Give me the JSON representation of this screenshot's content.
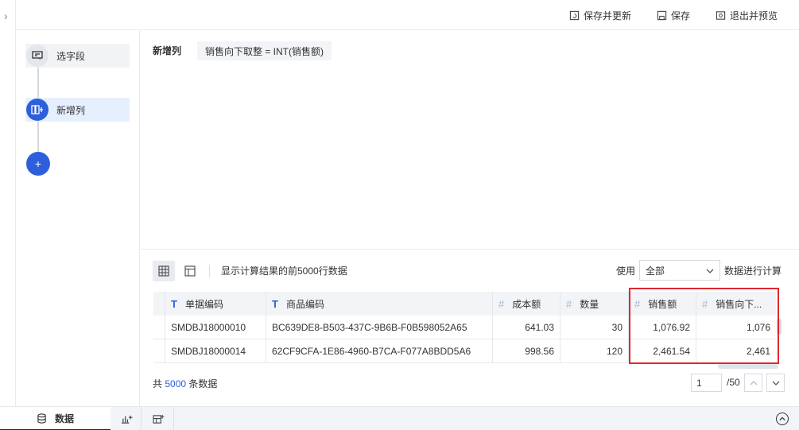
{
  "toolbar": {
    "save_refresh": "保存并更新",
    "save": "保存",
    "exit_preview": "退出并预览"
  },
  "steps": [
    {
      "label": "选字段",
      "icon": "select-field-icon"
    },
    {
      "label": "新增列",
      "icon": "add-column-icon",
      "badge": "ᵢ",
      "active": true
    }
  ],
  "add_step_label": "+",
  "formula": {
    "title": "新增列",
    "expression": "销售向下取整 = INT(销售额)"
  },
  "preview": {
    "hint": "显示计算结果的前5000行数据",
    "use_label": "使用",
    "scope_value": "全部",
    "scope_suffix": "数据进行计算"
  },
  "table": {
    "columns": [
      {
        "label": "单据编码",
        "type": "text"
      },
      {
        "label": "商品编码",
        "type": "text"
      },
      {
        "label": "成本额",
        "type": "number"
      },
      {
        "label": "数量",
        "type": "number"
      },
      {
        "label": "销售额",
        "type": "number"
      },
      {
        "label": "销售向下...",
        "type": "number"
      }
    ],
    "rows": [
      [
        "SMDBJ18000010",
        "BC639DE8-B503-437C-9B6B-F0B598052A65",
        "641.03",
        "30",
        "1,076.92",
        "1,076"
      ],
      [
        "SMDBJ18000014",
        "62CF9CFA-1E86-4960-B7CA-F077A8BDD5A6",
        "998.56",
        "120",
        "2,461.54",
        "2,461"
      ]
    ]
  },
  "footer": {
    "total_prefix": "共",
    "total_count": "5000",
    "total_suffix": "条数据",
    "page_value": "1",
    "page_total": "/50"
  },
  "bottom_tabs": [
    {
      "label": "数据",
      "icon": "database-icon"
    },
    {
      "label": "",
      "icon": "add-chart-icon"
    },
    {
      "label": "",
      "icon": "add-dashboard-icon"
    }
  ],
  "colors": {
    "accent": "#2d5fdc",
    "highlight": "#e0282e"
  }
}
